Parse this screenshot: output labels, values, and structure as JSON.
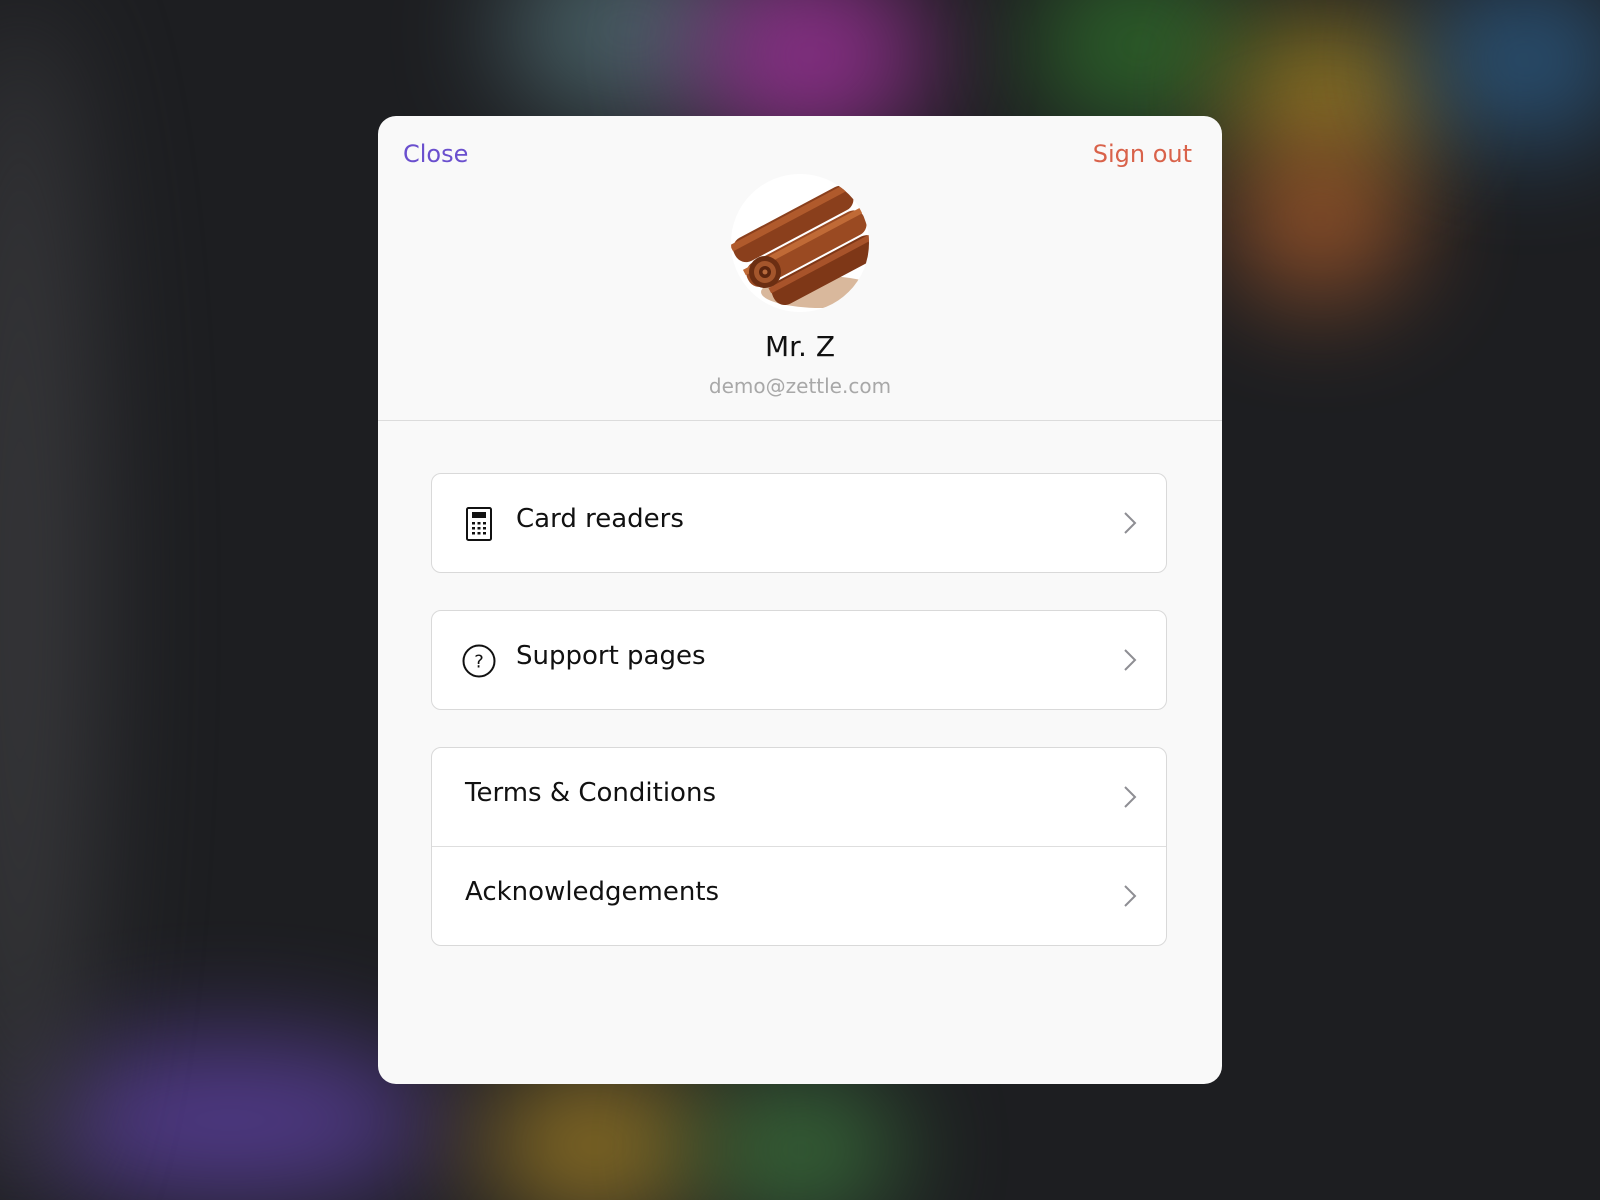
{
  "header": {
    "close_label": "Close",
    "signout_label": "Sign out"
  },
  "profile": {
    "name": "Mr. Z",
    "email": "demo@zettle.com",
    "avatar_icon": "cinnamon-sticks-photo"
  },
  "menu_groups": [
    [
      {
        "label": "Card readers",
        "icon": "card-reader-icon"
      }
    ],
    [
      {
        "label": "Support pages",
        "icon": "question-circle-icon"
      }
    ],
    [
      {
        "label": "Terms & Conditions"
      },
      {
        "label": "Acknowledgements"
      }
    ]
  ],
  "colors": {
    "close_accent": "#6a4fce",
    "signout_accent": "#d9624a",
    "chevron": "#8e8e93"
  }
}
